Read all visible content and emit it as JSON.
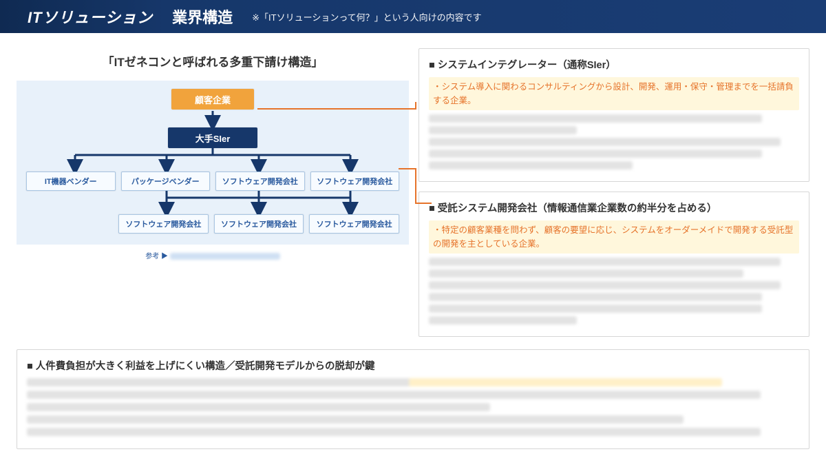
{
  "header": {
    "main": "ITソリューション",
    "sub": "業界構造",
    "note": "※「ITソリューションって何？」という人向けの内容です"
  },
  "diagram": {
    "title": "「ITゼネコンと呼ばれる多重下請け構造」",
    "top_node": "顧客企業",
    "tier1": "大手SIer",
    "tier2": [
      "IT機器ベンダー",
      "パッケージベンダー",
      "ソフトウェア開発会社",
      "ソフトウェア開発会社"
    ],
    "tier3": [
      "ソフトウェア開発会社",
      "ソフトウェア開発会社",
      "ソフトウェア開発会社"
    ],
    "reference_prefix": "参考 ▶"
  },
  "card1": {
    "title": "■ システムインテグレーター（通称SIer）",
    "highlight": "システム導入に関わるコンサルティングから設計、開発、運用・保守・管理までを一括請負する企業。"
  },
  "card2": {
    "title": "■ 受託システム開発会社（情報通信業企業数の約半分を占める）",
    "highlight": "特定の顧客業種を問わず、顧客の要望に応じ、システムをオーダーメイドで開発する受託型の開発を主としている企業。"
  },
  "bottom": {
    "title": "■ 人件費負担が大きく利益を上げにくい構造／受託開発モデルからの脱却が鍵"
  }
}
